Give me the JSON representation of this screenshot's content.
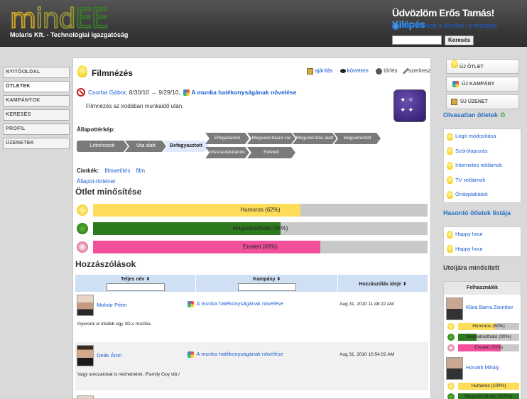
{
  "header": {
    "logo_m": "m",
    "logo_ind": "ind",
    "logo_ee": "EE",
    "subtitle": "Molaris Kft. - Technológiai igazgatóság",
    "welcome": "Üdvözlöm Erős Tamás!",
    "logout": "Kilépés",
    "info_link": "Ismerje meg a Mindee új verzióját",
    "search_button": "Keresés",
    "search_placeholder": ""
  },
  "nav": {
    "items": [
      {
        "label": "NYITÓOLDAL"
      },
      {
        "label": "ÖTLETEK"
      },
      {
        "label": "KAMPÁNYOK"
      },
      {
        "label": "KERESÉS"
      },
      {
        "label": "PROFIL"
      },
      {
        "label": "ÜZENETEK"
      }
    ]
  },
  "idea": {
    "title": "Filmnézés",
    "actions": {
      "recommend": "ajánlás",
      "follow": "követem",
      "delete": "törlés",
      "edit": "szerkesztés"
    },
    "author": "Csorba Gábor",
    "dates": ", 8/30/10 → 9/29/10,",
    "campaign": "A munka hatékonyságának növelése",
    "description": "Filmnézés az irodában munkaidő után.",
    "state_label": "Állapottérkép:",
    "states": {
      "created": "Létrehozott",
      "debate": "Vita alatt",
      "frozen": "Befagyasztott",
      "accepted": "Elfogadandó",
      "implement_candidate": "Megvalósításra vár",
      "in_progress": "Megvalósítás alatt",
      "implemented": "Megvalósított",
      "withdrawn": "Visszautasítandó",
      "rejected": "Elvetett"
    },
    "tags_label": "Cimkék:",
    "tags": [
      "filmvetítés",
      "film"
    ],
    "history_link": "Állapot-történet"
  },
  "rating": {
    "title": "Ötlet minősítése",
    "bars": [
      {
        "label": "Humoros (62%)",
        "value": 62,
        "color": "#fedd5a",
        "icon": "smiley-icon"
      },
      {
        "label": "Megvalósítható (56%)",
        "value": 56,
        "color": "#2e7a1f",
        "icon": "gear-icon"
      },
      {
        "label": "Eredeti (68%)",
        "value": 68,
        "color": "#f2509a",
        "icon": "flower-icon"
      }
    ]
  },
  "comments": {
    "title": "Hozzászólások",
    "columns": [
      "Teljes név ⬍",
      "Kampány ⬍",
      "Hozzászólás ideje ⬍"
    ],
    "rows": [
      {
        "name": "Molnár Péter",
        "campaign": "A munka hatékonyságának növelése",
        "date": "Aug 31, 2010 11:48:22 AM",
        "text": "Gyerünk el inkább egy 3D-s moziba"
      },
      {
        "name": "Deák Áron",
        "campaign": "A munka hatékonyságának növelése",
        "date": "Aug 31, 2010 10:54:02 AM",
        "text": "Vagy sorozatokat is nézhetnénk. /Family Guy stb./"
      }
    ]
  },
  "right": {
    "new_idea": "ÚJ ÖTLET",
    "new_campaign": "ÚJ KAMPÁNY",
    "new_message": "ÚJ ÜZENET",
    "unread_title": "Olvasatlan ötletek",
    "unread": [
      "Logó módosítása",
      "Szórólapozás",
      "Internetes reklámok",
      "TV reklámok",
      "Óriásplakátok"
    ],
    "similar_title": "Hasonló ötletek listája",
    "similar": [
      "Happy hour",
      "Happy hour"
    ],
    "last_rated_title": "Utoljára minősített",
    "users_title": "Felhasználók",
    "users": [
      {
        "name": "Klára Barna Zsombor",
        "bars": [
          {
            "label": "Humoros (60%)",
            "value": 60,
            "color": "#fedd5a"
          },
          {
            "label": "Megvalósítható (30%)",
            "value": 30,
            "color": "#2e7a1f"
          },
          {
            "label": "Eredeti (70%)",
            "value": 70,
            "color": "#f2509a"
          }
        ]
      },
      {
        "name": "Horváth Mihály",
        "bars": [
          {
            "label": "Humoros (100%)",
            "value": 100,
            "color": "#fedd5a"
          },
          {
            "label": "Megvalósítható (100%)",
            "value": 100,
            "color": "#2e7a1f"
          }
        ]
      }
    ]
  }
}
